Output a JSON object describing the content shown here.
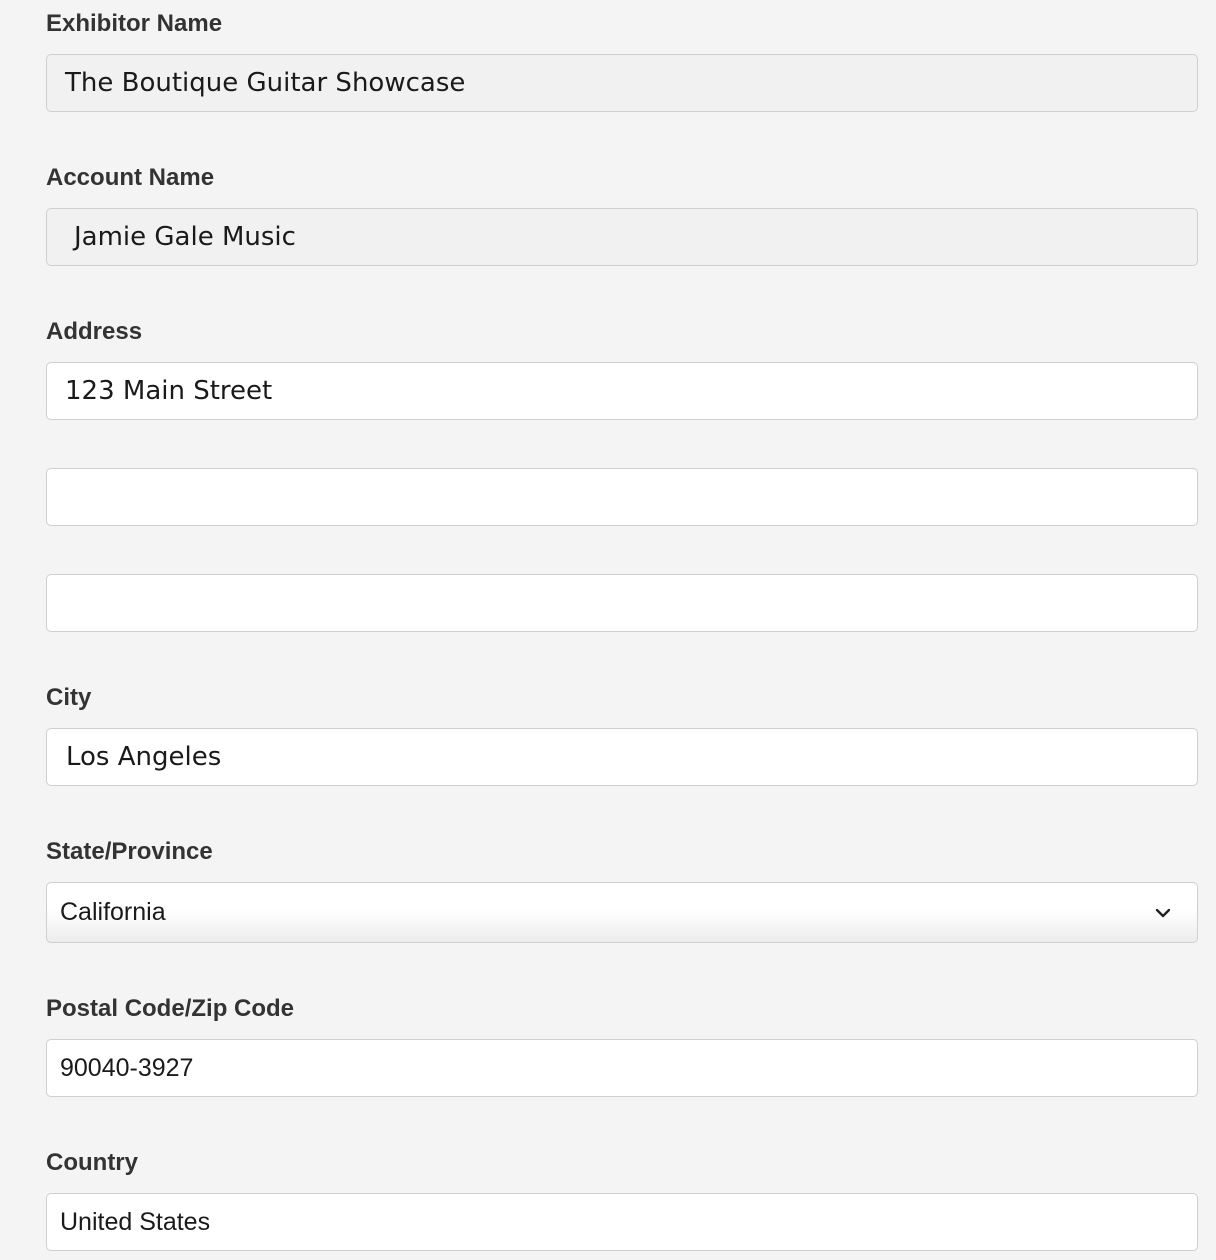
{
  "form": {
    "exhibitor_name": {
      "label": "Exhibitor Name",
      "value": "The Boutique Guitar Showcase"
    },
    "account_name": {
      "label": "Account Name",
      "value": "Jamie Gale Music"
    },
    "address": {
      "label": "Address",
      "line1": "123 Main Street",
      "line2": "",
      "line3": ""
    },
    "city": {
      "label": "City",
      "value": "Los Angeles"
    },
    "state": {
      "label": "State/Province",
      "value": "California",
      "icon": "chevron-down-icon"
    },
    "postal_code": {
      "label": "Postal Code/Zip Code",
      "value": "90040-3927"
    },
    "country": {
      "label": "Country",
      "value": "United States"
    }
  }
}
